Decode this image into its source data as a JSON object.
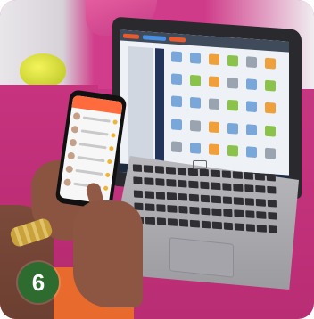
{
  "badge": {
    "number": "6"
  }
}
